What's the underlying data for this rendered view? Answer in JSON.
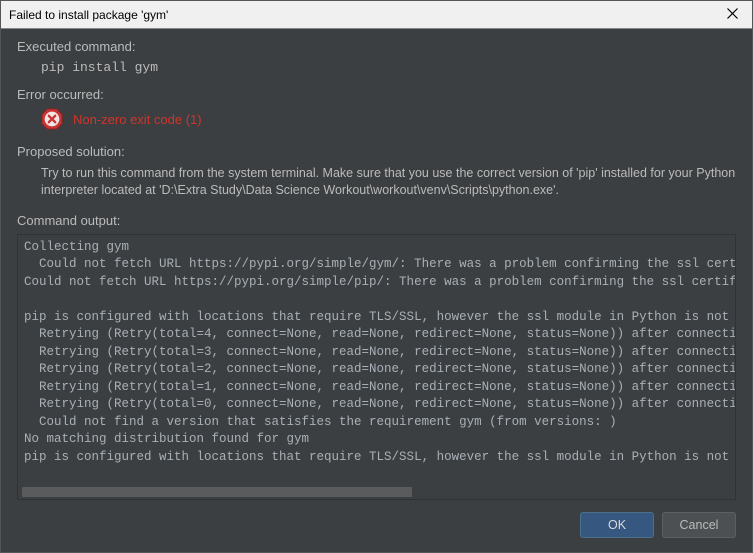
{
  "title": "Failed to install package 'gym'",
  "labels": {
    "executed": "Executed command:",
    "error": "Error occurred:",
    "solution": "Proposed solution:",
    "output": "Command output:"
  },
  "command": "pip install gym",
  "error_message": "Non-zero exit code (1)",
  "solution_text": "Try to run this command from the system terminal. Make sure that you use the correct version of 'pip' installed for your Python interpreter located at 'D:\\Extra Study\\Data Science Workout\\workout\\venv\\Scripts\\python.exe'.",
  "output_text": "Collecting gym\n  Could not fetch URL https://pypi.org/simple/gym/: There was a problem confirming the ssl certif\nCould not fetch URL https://pypi.org/simple/pip/: There was a problem confirming the ssl certific\n\npip is configured with locations that require TLS/SSL, however the ssl module in Python is not av\n  Retrying (Retry(total=4, connect=None, read=None, redirect=None, status=None)) after connection\n  Retrying (Retry(total=3, connect=None, read=None, redirect=None, status=None)) after connection\n  Retrying (Retry(total=2, connect=None, read=None, redirect=None, status=None)) after connection\n  Retrying (Retry(total=1, connect=None, read=None, redirect=None, status=None)) after connection\n  Retrying (Retry(total=0, connect=None, read=None, redirect=None, status=None)) after connection\n  Could not find a version that satisfies the requirement gym (from versions: )\nNo matching distribution found for gym\npip is configured with locations that require TLS/SSL, however the ssl module in Python is not av",
  "buttons": {
    "ok": "OK",
    "cancel": "Cancel"
  }
}
